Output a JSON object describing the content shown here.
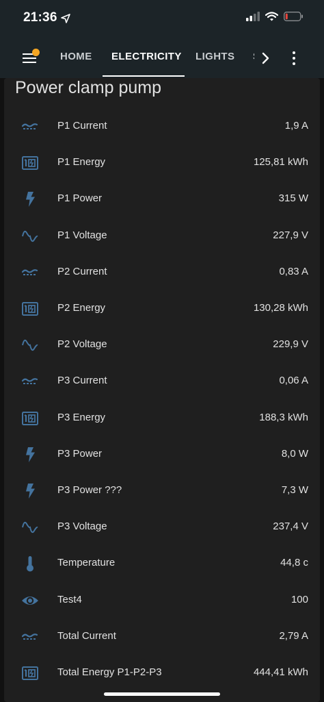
{
  "status_bar": {
    "time": "21:36"
  },
  "header": {
    "tabs": [
      {
        "label": "HOME"
      },
      {
        "label": "ELECTRICITY"
      },
      {
        "label": "LIGHTS"
      },
      {
        "label": "S"
      }
    ],
    "active_tab": "ELECTRICITY"
  },
  "card": {
    "title": "Power clamp pump",
    "entities": [
      {
        "name": "P1 Current",
        "value": "1,9 A",
        "icon": "current-ac-icon"
      },
      {
        "name": "P1 Energy",
        "value": "125,81 kWh",
        "icon": "meter-icon"
      },
      {
        "name": "P1 Power",
        "value": "315 W",
        "icon": "flash-icon"
      },
      {
        "name": "P1 Voltage",
        "value": "227,9 V",
        "icon": "sine-wave-icon"
      },
      {
        "name": "P2 Current",
        "value": "0,83 A",
        "icon": "current-ac-icon"
      },
      {
        "name": "P2 Energy",
        "value": "130,28 kWh",
        "icon": "meter-icon"
      },
      {
        "name": "P2 Voltage",
        "value": "229,9 V",
        "icon": "sine-wave-icon"
      },
      {
        "name": "P3 Current",
        "value": "0,06 A",
        "icon": "current-ac-icon"
      },
      {
        "name": "P3 Energy",
        "value": "188,3 kWh",
        "icon": "meter-icon"
      },
      {
        "name": "P3 Power",
        "value": "8,0 W",
        "icon": "flash-icon"
      },
      {
        "name": "P3 Power ???",
        "value": "7,3 W",
        "icon": "flash-icon"
      },
      {
        "name": "P3 Voltage",
        "value": "237,4 V",
        "icon": "sine-wave-icon"
      },
      {
        "name": "Temperature",
        "value": "44,8 c",
        "icon": "thermometer-icon"
      },
      {
        "name": "Test4",
        "value": "100",
        "icon": "eye-icon"
      },
      {
        "name": "Total Current",
        "value": "2,79 A",
        "icon": "current-ac-icon"
      },
      {
        "name": "Total Energy P1-P2-P3",
        "value": "444,41 kWh",
        "icon": "meter-icon"
      }
    ]
  },
  "colors": {
    "app_bar": "#1c2428",
    "background": "#111111",
    "card": "#1f1f1f",
    "icon": "#44739e",
    "text": "#e1e1e1",
    "notification": "#f5a623",
    "battery_low": "#e8453c"
  }
}
